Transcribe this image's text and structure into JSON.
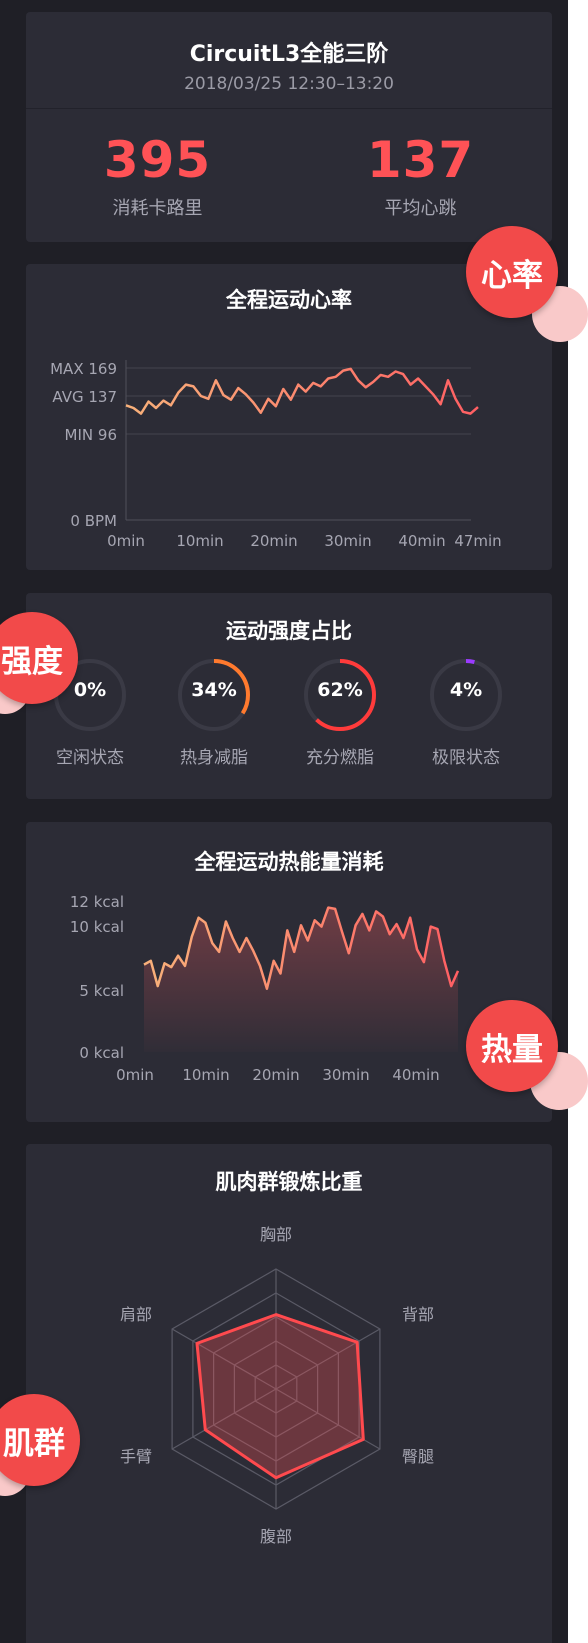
{
  "summary": {
    "title": "CircuitL3全能三阶",
    "time_range": "2018/03/25 12:30–13:20",
    "calories": {
      "value": "395",
      "label": "消耗卡路里"
    },
    "heart_rate": {
      "value": "137",
      "label": "平均心跳"
    }
  },
  "badges": {
    "heart": "心率",
    "intensity": "强度",
    "calorie": "热量",
    "muscle": "肌群"
  },
  "colors": {
    "accent": "#ff5256",
    "background": "#1f1f26",
    "card": "#2c2c36",
    "line_start": "#f8b17a",
    "line_end": "#ff5f63"
  },
  "heart_chart": {
    "title": "全程运动心率",
    "y_labels": {
      "max": "MAX 169",
      "avg": "AVG 137",
      "min": "MIN 96",
      "zero": "0 BPM"
    },
    "x_labels": [
      "0min",
      "10min",
      "20min",
      "30min",
      "40min",
      "47min"
    ]
  },
  "intensity": {
    "title": "运动强度占比",
    "items": [
      {
        "pct": "0%",
        "label": "空闲状态",
        "value": 0,
        "color": "#8a8a96"
      },
      {
        "pct": "34%",
        "label": "热身减脂",
        "value": 0.34,
        "color": "#ff7a2e"
      },
      {
        "pct": "62%",
        "label": "充分燃脂",
        "value": 0.62,
        "color": "#ff3b3b"
      },
      {
        "pct": "4%",
        "label": "极限状态",
        "value": 0.04,
        "color": "#9b3bff"
      }
    ]
  },
  "calorie_chart": {
    "title": "全程运动热能量消耗",
    "y_labels": [
      "12 kcal",
      "10 kcal",
      "5 kcal",
      "0 kcal"
    ],
    "x_labels": [
      "0min",
      "10min",
      "20min",
      "30min",
      "40min"
    ]
  },
  "muscle_chart": {
    "title": "肌肉群锻炼比重",
    "axes": [
      "胸部",
      "背部",
      "臀腿",
      "腹部",
      "手臂",
      "肩部"
    ]
  },
  "chart_data": [
    {
      "type": "line",
      "title": "全程运动心率",
      "x": [
        0,
        1,
        2,
        3,
        4,
        5,
        6,
        7,
        8,
        9,
        10,
        11,
        12,
        13,
        14,
        15,
        16,
        17,
        18,
        19,
        20,
        21,
        22,
        23,
        24,
        25,
        26,
        27,
        28,
        29,
        30,
        31,
        32,
        33,
        34,
        35,
        36,
        37,
        38,
        39,
        40,
        41,
        42,
        43,
        44,
        45,
        46,
        47
      ],
      "y": [
        127,
        124,
        118,
        131,
        124,
        132,
        127,
        141,
        150,
        148,
        137,
        134,
        155,
        138,
        133,
        146,
        139,
        130,
        119,
        134,
        126,
        145,
        133,
        150,
        142,
        152,
        148,
        157,
        159,
        166,
        168,
        155,
        147,
        153,
        161,
        159,
        165,
        162,
        150,
        157,
        148,
        139,
        128,
        155,
        134,
        120,
        118,
        125
      ],
      "ylim": [
        0,
        169
      ],
      "annotations": {
        "max": 169,
        "avg": 137,
        "min": 96
      }
    },
    {
      "type": "area",
      "title": "全程运动热能量消耗",
      "x": [
        0,
        1,
        2,
        3,
        4,
        5,
        6,
        7,
        8,
        9,
        10,
        11,
        12,
        13,
        14,
        15,
        16,
        17,
        18,
        19,
        20,
        21,
        22,
        23,
        24,
        25,
        26,
        27,
        28,
        29,
        30,
        31,
        32,
        33,
        34,
        35,
        36,
        37,
        38,
        39,
        40,
        41,
        42,
        43,
        44,
        45,
        46
      ],
      "y": [
        6.9,
        7.2,
        5.2,
        7.0,
        6.7,
        7.6,
        6.8,
        9.1,
        10.6,
        10.2,
        8.6,
        7.9,
        10.3,
        9.0,
        7.9,
        9.0,
        8.0,
        6.8,
        5.0,
        7.2,
        6.2,
        9.6,
        7.9,
        10.0,
        8.8,
        10.4,
        9.9,
        11.4,
        11.3,
        9.5,
        7.8,
        10.0,
        10.9,
        9.6,
        11.1,
        10.7,
        9.3,
        10.1,
        9.0,
        10.6,
        8.1,
        7.1,
        9.9,
        9.7,
        7.2,
        5.2,
        6.4
      ],
      "ylim": [
        0,
        12
      ]
    },
    {
      "type": "radar",
      "title": "肌肉群锻炼比重",
      "categories": [
        "胸部",
        "背部",
        "臀腿",
        "腹部",
        "手臂",
        "肩部"
      ],
      "values": [
        0.62,
        0.78,
        0.84,
        0.74,
        0.68,
        0.76
      ],
      "max": 1.0
    }
  ]
}
